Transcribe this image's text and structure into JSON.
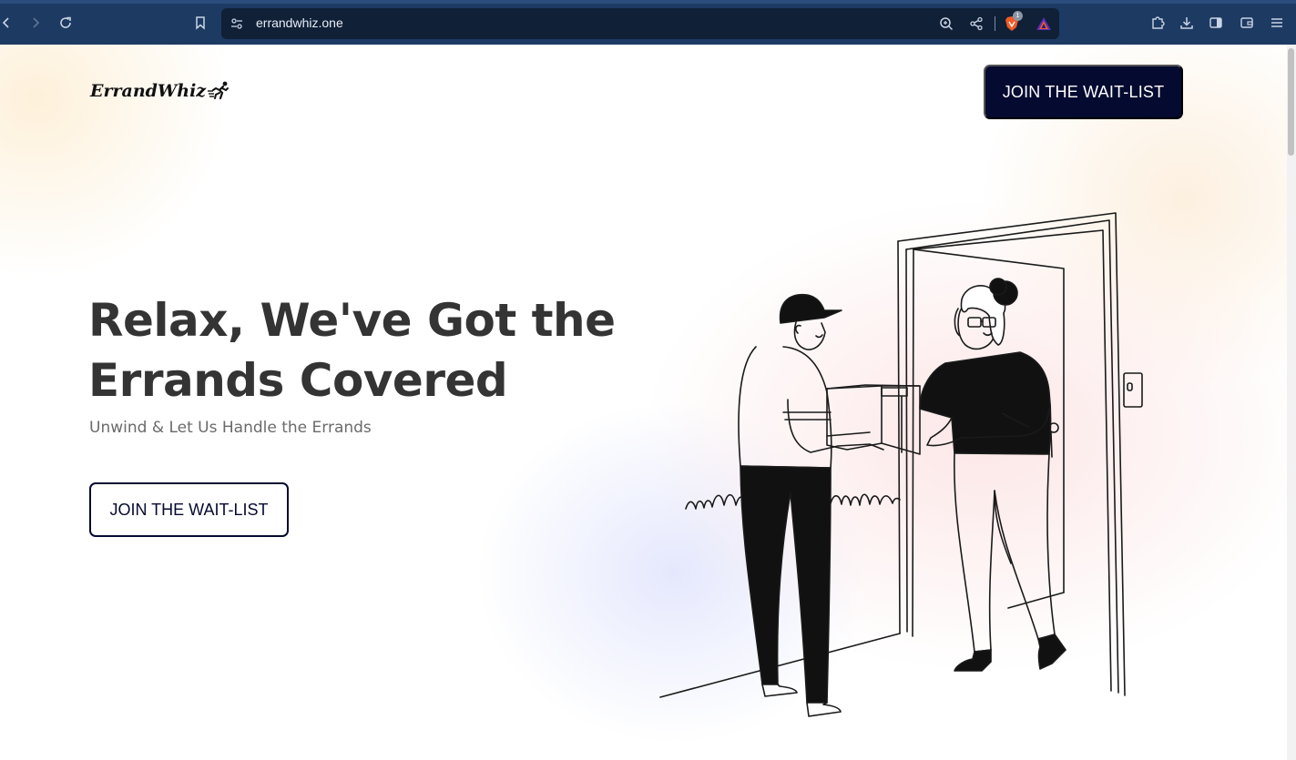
{
  "browser": {
    "url": "errandwhiz.one",
    "extension_badge_count": "1"
  },
  "header": {
    "logo_text": "ErrandWhiz",
    "cta_label": "JOIN THE WAIT-LIST"
  },
  "hero": {
    "headline_line1": "Relax, We've Got the",
    "headline_line2": "Errands Covered",
    "subheadline": "Unwind & Let Us Handle the Errands",
    "cta_label": "JOIN THE WAIT-LIST",
    "illustration_icon": "delivery-illustration"
  },
  "colors": {
    "chrome_bg": "#1d3a63",
    "urlbar_bg": "#0f2037",
    "brand_dark": "#050a30",
    "headline": "#343434",
    "subheadline": "#6a6a6a"
  }
}
